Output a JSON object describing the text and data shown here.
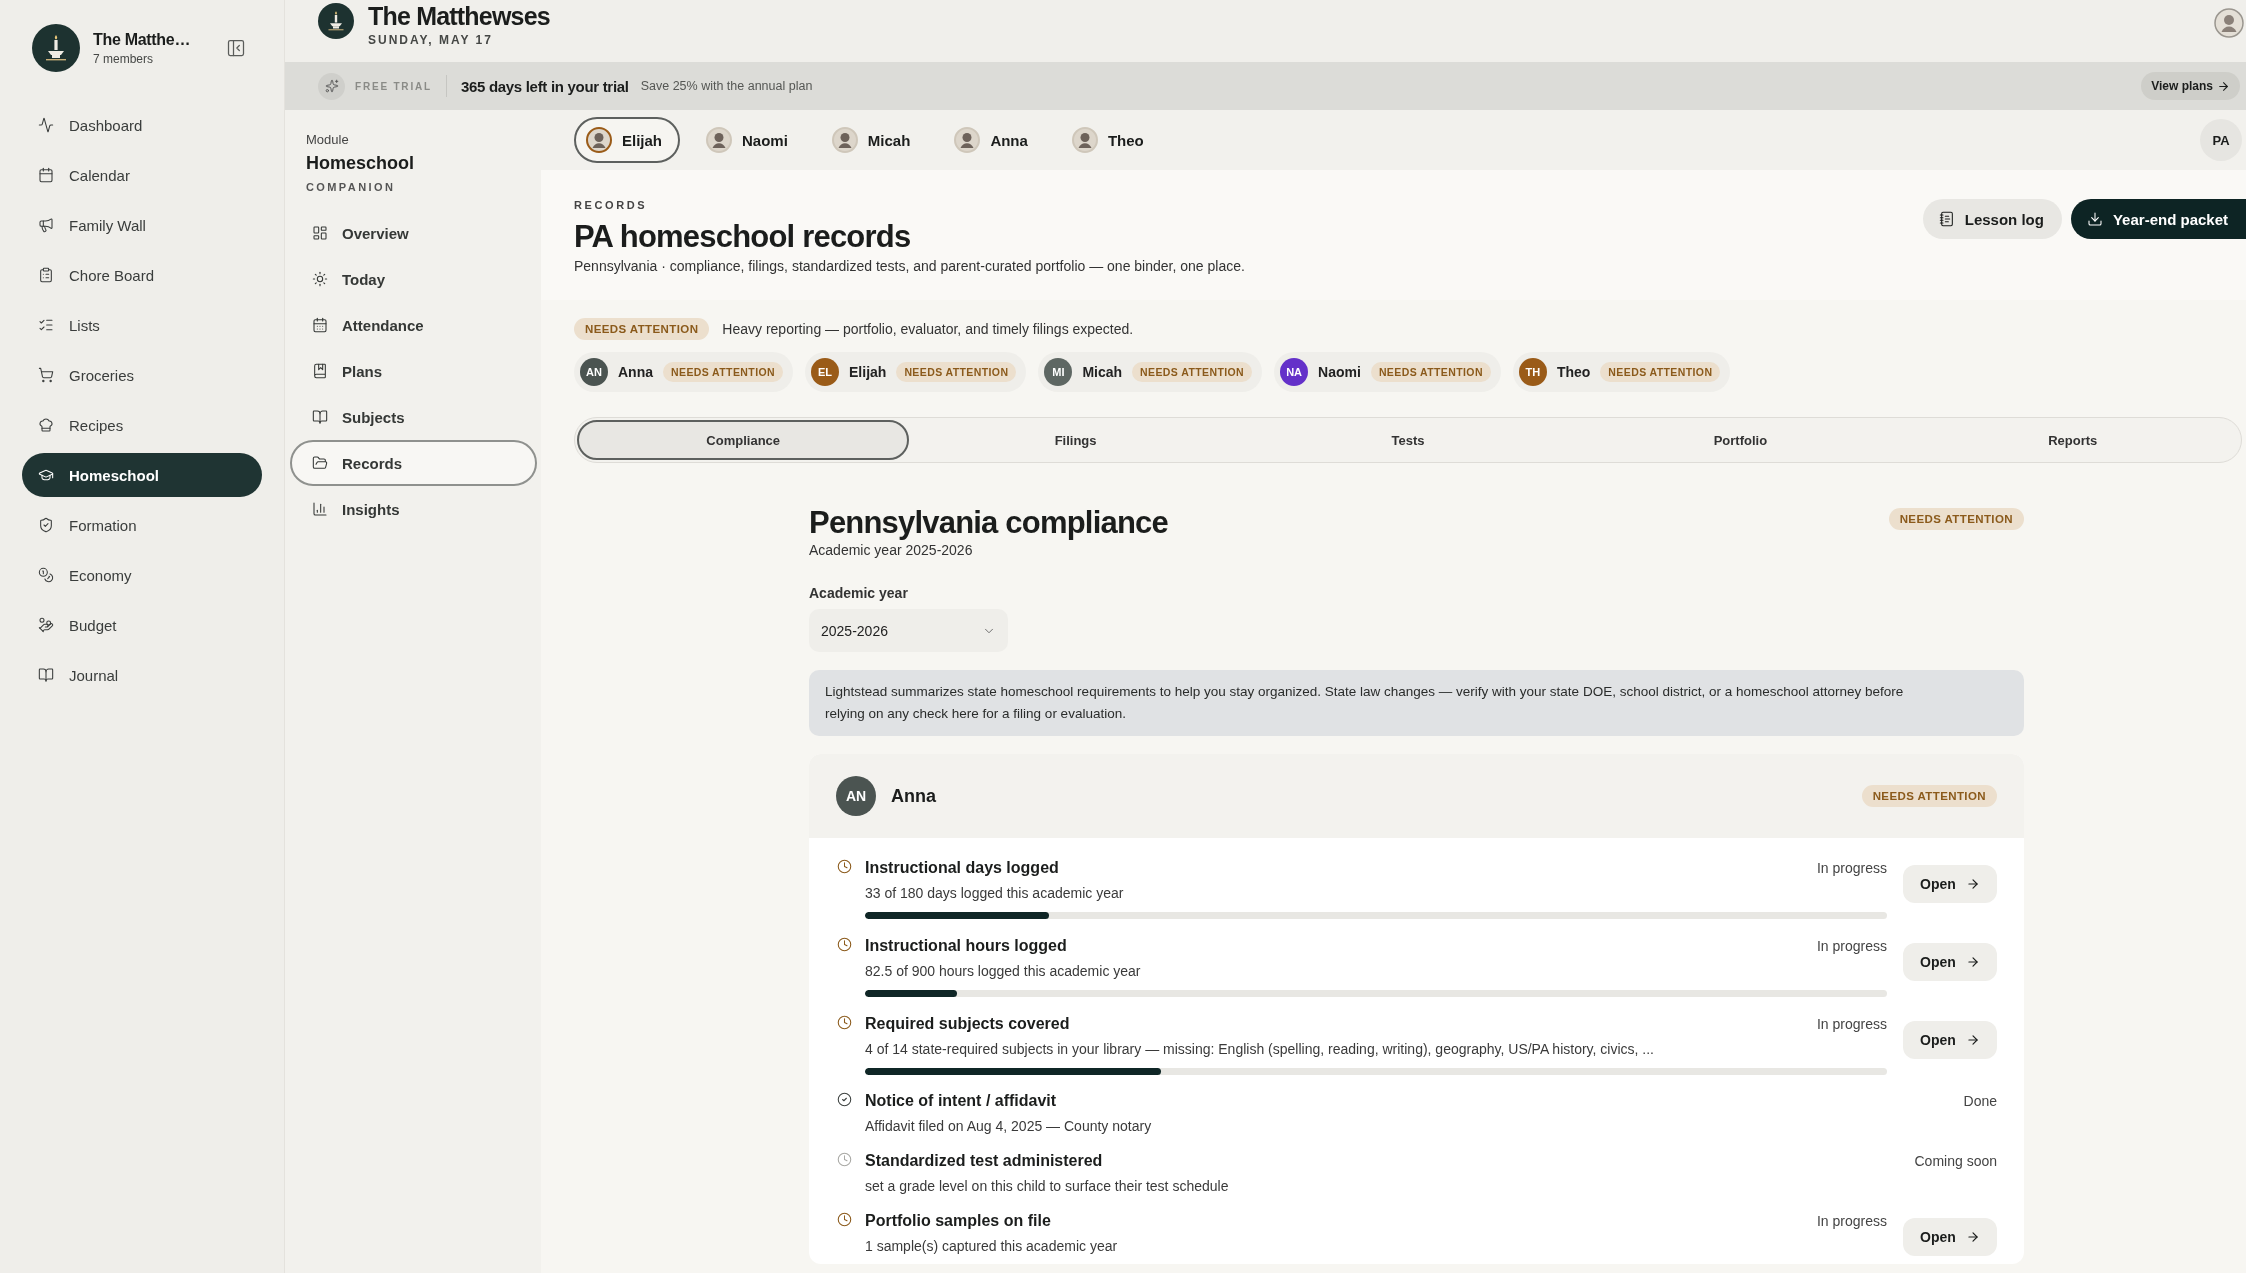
{
  "sidebar": {
    "family_name": "The Matthe…",
    "members": "7 members",
    "items": [
      {
        "label": "Dashboard",
        "selected": false
      },
      {
        "label": "Calendar",
        "selected": false
      },
      {
        "label": "Family Wall",
        "selected": false
      },
      {
        "label": "Chore Board",
        "selected": false
      },
      {
        "label": "Lists",
        "selected": false
      },
      {
        "label": "Groceries",
        "selected": false
      },
      {
        "label": "Recipes",
        "selected": false
      },
      {
        "label": "Homeschool",
        "selected": true
      },
      {
        "label": "Formation",
        "selected": false
      },
      {
        "label": "Economy",
        "selected": false
      },
      {
        "label": "Budget",
        "selected": false
      },
      {
        "label": "Journal",
        "selected": false
      }
    ]
  },
  "header": {
    "title": "The Matthewses",
    "date": "SUNDAY, MAY 17"
  },
  "trial_banner": {
    "label": "FREE TRIAL",
    "headline": "365 days left in your trial",
    "offer": "Save 25% with the annual plan",
    "action": "View plans"
  },
  "module_nav": {
    "caption": "Module",
    "title": "Homeschool",
    "subtitle": "COMPANION",
    "items": [
      {
        "label": "Overview",
        "selected": false
      },
      {
        "label": "Today",
        "selected": false
      },
      {
        "label": "Attendance",
        "selected": false
      },
      {
        "label": "Plans",
        "selected": false
      },
      {
        "label": "Subjects",
        "selected": false
      },
      {
        "label": "Records",
        "selected": true
      },
      {
        "label": "Insights",
        "selected": false
      }
    ]
  },
  "child_tabs": {
    "items": [
      {
        "name": "Elijah",
        "selected": true
      },
      {
        "name": "Naomi",
        "selected": false
      },
      {
        "name": "Micah",
        "selected": false
      },
      {
        "name": "Anna",
        "selected": false
      },
      {
        "name": "Theo",
        "selected": false
      }
    ],
    "profile": "PA"
  },
  "page_header": {
    "eyebrow": "RECORDS",
    "title": "PA homeschool records",
    "description": "Pennsylvania · compliance, filings, standardized tests, and parent-curated portfolio — one binder, one place.",
    "buttons": [
      {
        "label": "Lesson log",
        "kind": "secondary"
      },
      {
        "label": "Year-end packet",
        "kind": "primary"
      }
    ]
  },
  "attention": {
    "badge": "NEEDS ATTENTION",
    "text": "Heavy reporting — portfolio, evaluator, and timely filings expected."
  },
  "children": [
    {
      "initials": "AN",
      "name": "Anna",
      "status": "NEEDS ATTENTION",
      "color": "#4b5451"
    },
    {
      "initials": "EL",
      "name": "Elijah",
      "status": "NEEDS ATTENTION",
      "color": "#9a5b18"
    },
    {
      "initials": "MI",
      "name": "Micah",
      "status": "NEEDS ATTENTION",
      "color": "#5e6763"
    },
    {
      "initials": "NA",
      "name": "Naomi",
      "status": "NEEDS ATTENTION",
      "color": "#6431c9"
    },
    {
      "initials": "TH",
      "name": "Theo",
      "status": "NEEDS ATTENTION",
      "color": "#9a5b18"
    }
  ],
  "section_tabs": [
    {
      "label": "Compliance",
      "selected": true
    },
    {
      "label": "Filings",
      "selected": false
    },
    {
      "label": "Tests",
      "selected": false
    },
    {
      "label": "Portfolio",
      "selected": false
    },
    {
      "label": "Reports",
      "selected": false
    }
  ],
  "compliance": {
    "title": "Pennsylvania compliance",
    "subtitle": "Academic year 2025-2026",
    "status": "NEEDS ATTENTION",
    "year_field": {
      "label": "Academic year",
      "value": "2025-2026"
    },
    "notice": "Lightstead summarizes state homeschool requirements to help you stay organized. State law changes — verify with your state DOE, school district, or a homeschool attorney before relying on any check here for a filing or evaluation.",
    "card": {
      "initials": "AN",
      "name": "Anna",
      "color": "#4b5451",
      "status": "NEEDS ATTENTION",
      "requirements": [
        {
          "kind": "progress",
          "title": "Instructional days logged",
          "detail": "33 of 180 days logged this academic year",
          "status": "In progress",
          "level": 0.18,
          "action": "Open"
        },
        {
          "kind": "progress",
          "title": "Instructional hours logged",
          "detail": "82.5 of 900 hours logged this academic year",
          "status": "In progress",
          "level": 0.09,
          "action": "Open"
        },
        {
          "kind": "progress",
          "title": "Required subjects covered",
          "detail": "4 of 14 state-required subjects in your library — missing: English (spelling, reading, writing), geography, US/PA history, civics, ...",
          "status": "In progress",
          "level": 0.29,
          "action": "Open"
        },
        {
          "kind": "done",
          "title": "Notice of intent / affidavit",
          "detail": "Affidavit filed on Aug 4, 2025 — County notary",
          "status": "Done"
        },
        {
          "kind": "pending",
          "title": "Standardized test administered",
          "detail": "set a grade level on this child to surface their test schedule",
          "status": "Coming soon"
        },
        {
          "kind": "progress",
          "title": "Portfolio samples on file",
          "detail": "1 sample(s) captured this academic year",
          "status": "In progress",
          "action": "Open"
        }
      ]
    }
  }
}
